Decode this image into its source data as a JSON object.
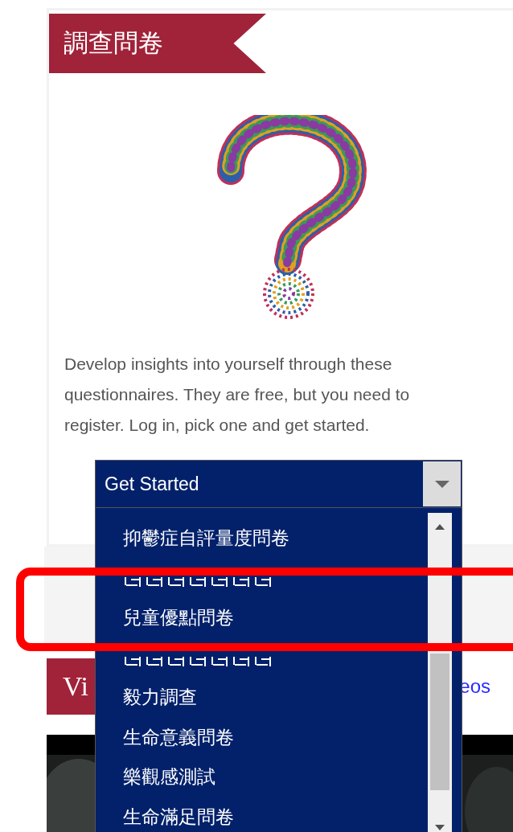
{
  "survey": {
    "title": "調查問卷",
    "description": "Develop insights into yourself through these questionnaires. They are free, but you need to register. Log in, pick one and get started."
  },
  "select": {
    "value": "Get Started",
    "options": [
      {
        "label": "抑鬱症自評量度問卷"
      },
      {
        "kind": "covered"
      },
      {
        "label": "兒童優點問卷"
      },
      {
        "kind": "covered"
      },
      {
        "label": "毅力調查"
      },
      {
        "label": "生命意義問卷"
      },
      {
        "label": "樂觀感測試"
      },
      {
        "label": "生命滿足問卷"
      }
    ]
  },
  "videos": {
    "title": "Vi",
    "link": "eos"
  }
}
